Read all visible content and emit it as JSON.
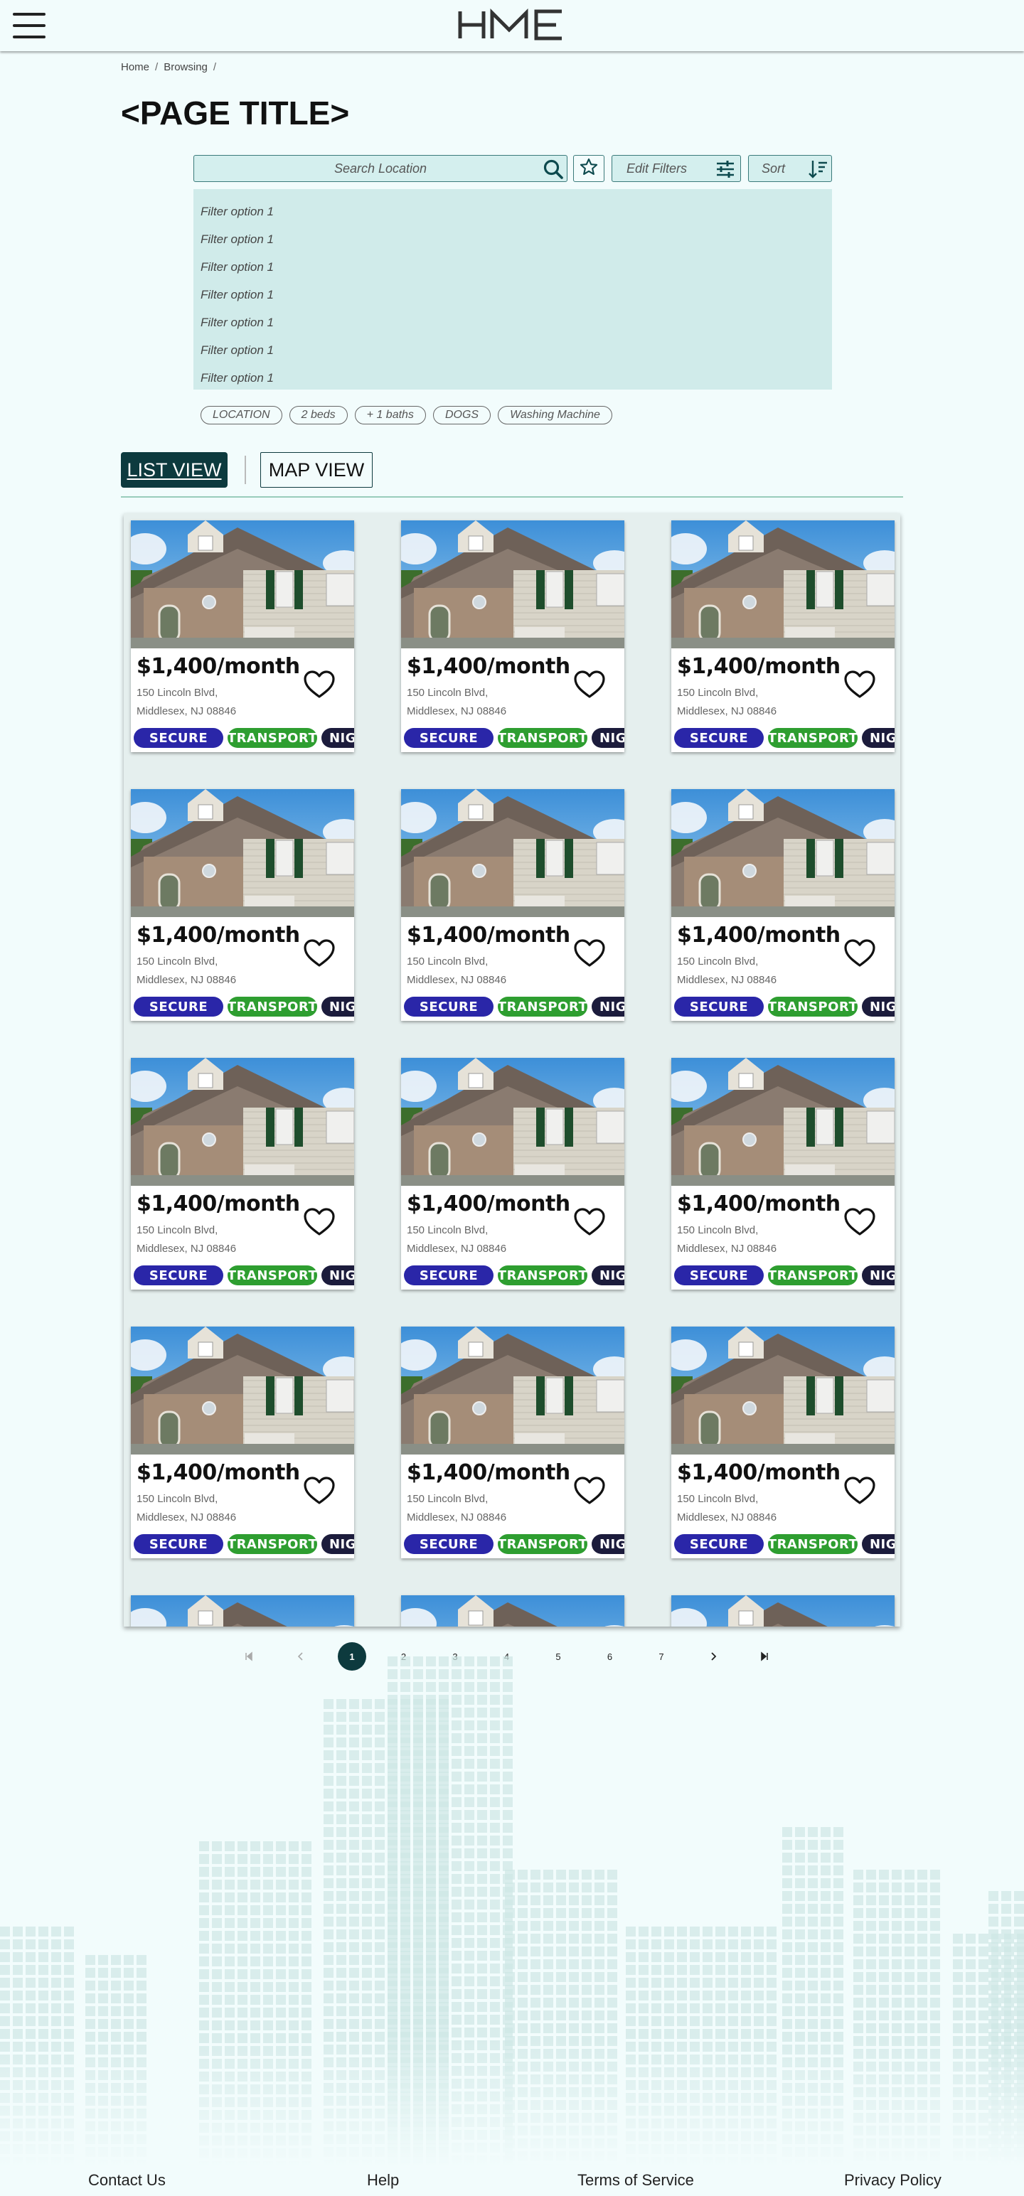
{
  "header": {
    "logo_text": "HME",
    "menu_icon": "hamburger-menu-icon"
  },
  "breadcrumb": {
    "items": [
      "Home",
      "Browsing"
    ],
    "separator": "/"
  },
  "page_title": "<PAGE TITLE>",
  "search": {
    "placeholder": "Search Location",
    "search_icon": "search-icon",
    "favorites_icon": "star-icon",
    "edit_filters_label": "Edit Filters",
    "edit_filters_icon": "sliders-icon",
    "sort_label": "Sort",
    "sort_icon": "sort-descending-icon"
  },
  "filter_options": [
    "Filter option 1",
    "Filter option 1",
    "Filter option 1",
    "Filter option 1",
    "Filter option 1",
    "Filter option 1",
    "Filter option 1"
  ],
  "chips": [
    "LOCATION",
    "2 beds",
    "+ 1 baths",
    "DOGS",
    "Washing Machine"
  ],
  "view_toggle": {
    "list_label": "LIST VIEW",
    "map_label": "MAP VIEW",
    "active": "list"
  },
  "listings": [
    {
      "price": "$1,400/month",
      "address_line1": "150 Lincoln Blvd,",
      "address_line2": "Middlesex, NJ 08846",
      "tags": [
        "SECURE",
        "TRANSPORT",
        "NIG"
      ]
    },
    {
      "price": "$1,400/month",
      "address_line1": "150 Lincoln Blvd,",
      "address_line2": "Middlesex, NJ 08846",
      "tags": [
        "SECURE",
        "TRANSPORT",
        "NIG"
      ]
    },
    {
      "price": "$1,400/month",
      "address_line1": "150 Lincoln Blvd,",
      "address_line2": "Middlesex, NJ 08846",
      "tags": [
        "SECURE",
        "TRANSPORT",
        "NIG"
      ]
    },
    {
      "price": "$1,400/month",
      "address_line1": "150 Lincoln Blvd,",
      "address_line2": "Middlesex, NJ 08846",
      "tags": [
        "SECURE",
        "TRANSPORT",
        "NIG"
      ]
    },
    {
      "price": "$1,400/month",
      "address_line1": "150 Lincoln Blvd,",
      "address_line2": "Middlesex, NJ 08846",
      "tags": [
        "SECURE",
        "TRANSPORT",
        "NIG"
      ]
    },
    {
      "price": "$1,400/month",
      "address_line1": "150 Lincoln Blvd,",
      "address_line2": "Middlesex, NJ 08846",
      "tags": [
        "SECURE",
        "TRANSPORT",
        "NIG"
      ]
    },
    {
      "price": "$1,400/month",
      "address_line1": "150 Lincoln Blvd,",
      "address_line2": "Middlesex, NJ 08846",
      "tags": [
        "SECURE",
        "TRANSPORT",
        "NIG"
      ]
    },
    {
      "price": "$1,400/month",
      "address_line1": "150 Lincoln Blvd,",
      "address_line2": "Middlesex, NJ 08846",
      "tags": [
        "SECURE",
        "TRANSPORT",
        "NIG"
      ]
    },
    {
      "price": "$1,400/month",
      "address_line1": "150 Lincoln Blvd,",
      "address_line2": "Middlesex, NJ 08846",
      "tags": [
        "SECURE",
        "TRANSPORT",
        "NIG"
      ]
    },
    {
      "price": "$1,400/month",
      "address_line1": "150 Lincoln Blvd,",
      "address_line2": "Middlesex, NJ 08846",
      "tags": [
        "SECURE",
        "TRANSPORT",
        "NIG"
      ]
    },
    {
      "price": "$1,400/month",
      "address_line1": "150 Lincoln Blvd,",
      "address_line2": "Middlesex, NJ 08846",
      "tags": [
        "SECURE",
        "TRANSPORT",
        "NIG"
      ]
    },
    {
      "price": "$1,400/month",
      "address_line1": "150 Lincoln Blvd,",
      "address_line2": "Middlesex, NJ 08846",
      "tags": [
        "SECURE",
        "TRANSPORT",
        "NIG"
      ]
    },
    {
      "price": "",
      "address_line1": "",
      "address_line2": "",
      "tags": []
    },
    {
      "price": "",
      "address_line1": "",
      "address_line2": "",
      "tags": []
    },
    {
      "price": "",
      "address_line1": "",
      "address_line2": "",
      "tags": []
    }
  ],
  "tag_colors": {
    "SECURE": "#2a26a8",
    "TRANSPORT": "#2e9e30",
    "NIG": "#1c1c3c"
  },
  "pagination": {
    "first_icon": "first-page-icon",
    "prev_icon": "chevron-left-icon",
    "pages": [
      "1",
      "2",
      "3",
      "4",
      "5",
      "6",
      "7"
    ],
    "current": "1",
    "next_icon": "chevron-right-icon",
    "last_icon": "last-page-icon"
  },
  "footer": {
    "links": [
      "Contact Us",
      "Help",
      "Terms of Service",
      "Privacy Policy"
    ]
  },
  "colors": {
    "background": "#f2fcfc",
    "accent_dark": "#0d3a3e",
    "input_fill": "#d4efee",
    "city_tint": "#cfe8e6"
  }
}
